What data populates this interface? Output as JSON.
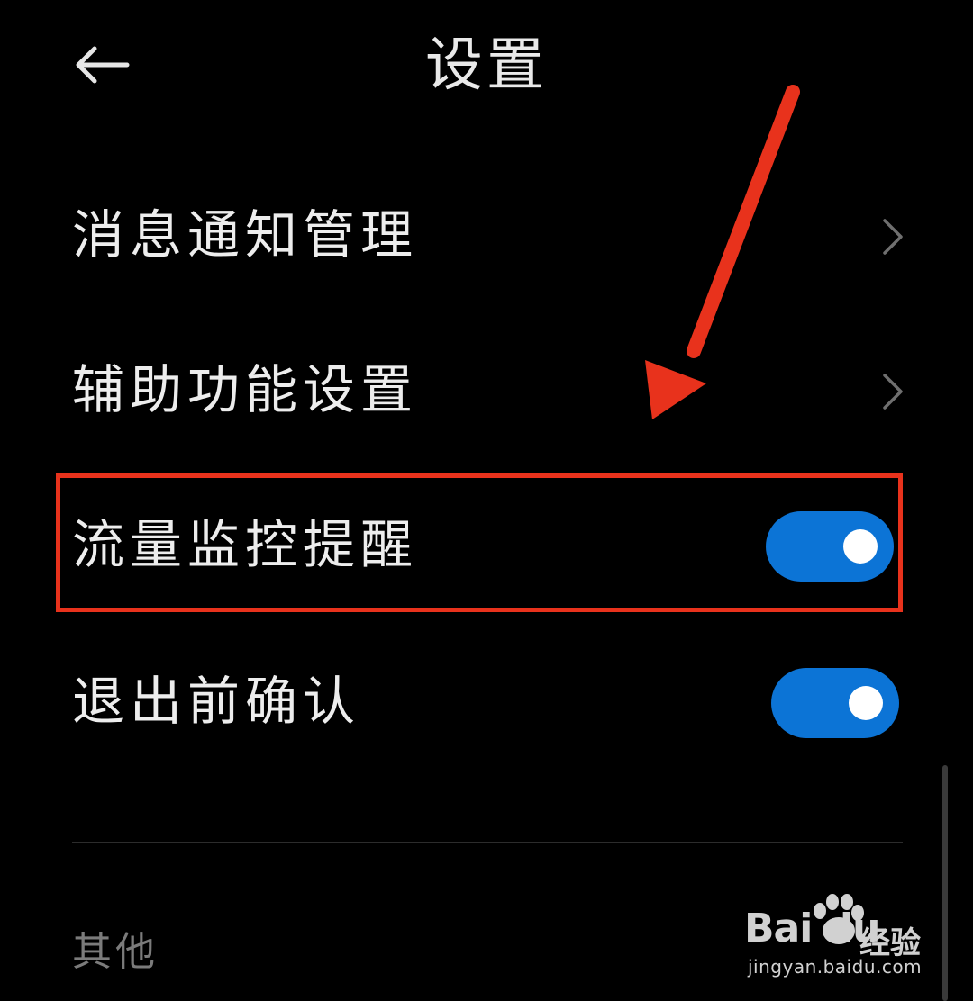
{
  "header": {
    "back_icon": "back-arrow-icon",
    "title": "设置"
  },
  "settings": [
    {
      "label": "消息通知管理",
      "control": "chevron",
      "icon": "chevron-right-icon"
    },
    {
      "label": "辅助功能设置",
      "control": "chevron",
      "icon": "chevron-right-icon"
    },
    {
      "label": "流量监控提醒",
      "control": "toggle",
      "on": true
    },
    {
      "label": "退出前确认",
      "control": "toggle",
      "on": true
    }
  ],
  "section_other": "其他",
  "annotation": {
    "highlight_color": "#e8321c",
    "arrow_color": "#e8321c"
  },
  "watermark": {
    "logo_text": "Bai du",
    "logo_cn": "经验",
    "url": "jingyan.baidu.com"
  },
  "colors": {
    "background": "#000000",
    "toggle_on": "#0c74d6",
    "text": "#ececec",
    "muted_text": "#7b7b7b"
  }
}
